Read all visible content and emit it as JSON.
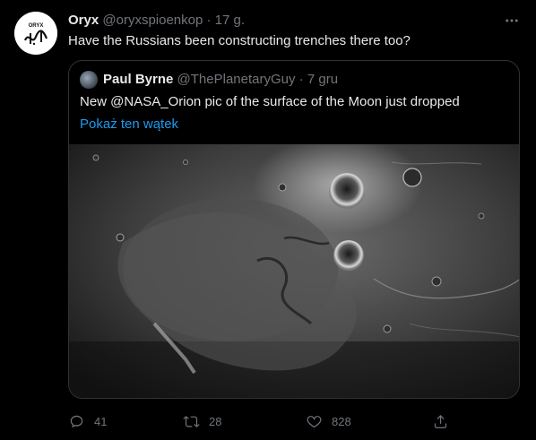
{
  "tweet": {
    "author_name": "Oryx",
    "handle": "@oryxspioenkop",
    "separator": "·",
    "time": "17 g.",
    "text": "Have the Russians been constructing trenches there too?"
  },
  "avatar": {
    "logo_text": "ORYX"
  },
  "quote": {
    "author_name": "Paul Byrne",
    "handle": "@ThePlanetaryGuy",
    "separator": "·",
    "time": "7 gru",
    "text": "New @NASA_Orion pic of the surface of the Moon just dropped",
    "show_thread": "Pokaż ten wątek"
  },
  "actions": {
    "reply_count": "41",
    "retweet_count": "28",
    "like_count": "828"
  },
  "icons": [
    "more-icon",
    "reply-icon",
    "retweet-icon",
    "like-icon",
    "share-icon"
  ],
  "colors": {
    "background": "#000000",
    "text": "#e7e9ea",
    "muted": "#71767b",
    "link": "#1d9bf0",
    "border": "#2f3336"
  }
}
